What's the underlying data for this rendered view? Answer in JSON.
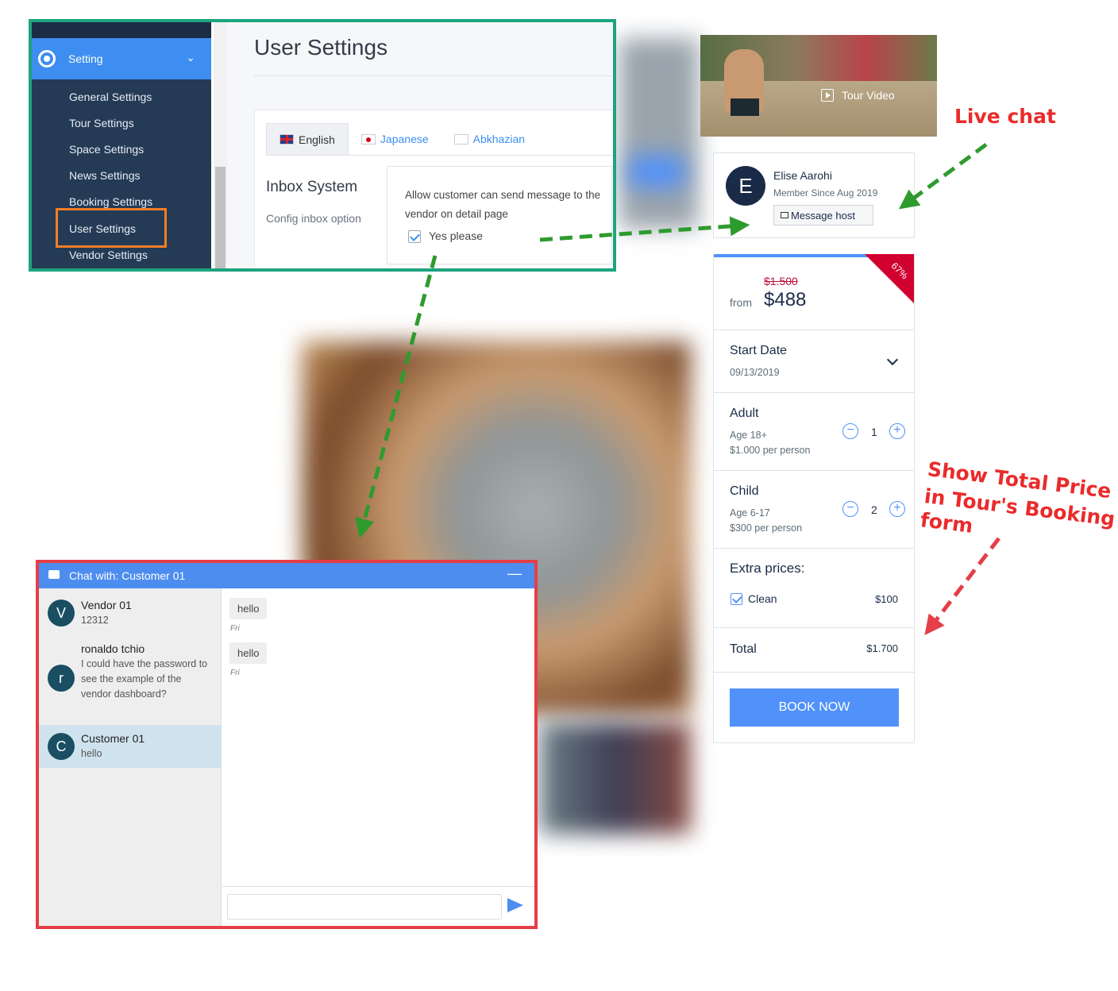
{
  "admin": {
    "menu": {
      "setting_label": "Setting",
      "items": [
        "General Settings",
        "Tour Settings",
        "Space Settings",
        "News Settings",
        "Booking Settings",
        "User Settings",
        "Vendor Settings"
      ]
    },
    "page_title": "User Settings",
    "tabs": [
      "English",
      "Japanese",
      "Abkhazian"
    ],
    "section_title": "Inbox System",
    "section_sub": "Config inbox option",
    "inbox_text": "Allow customer can send message to the vendor on detail page",
    "checkbox_label": "Yes please"
  },
  "tour": {
    "video_label": "Tour Video"
  },
  "host": {
    "initial": "E",
    "name": "Elise Aarohi",
    "member_since": "Member Since Aug 2019",
    "message_button": "Message host"
  },
  "booking": {
    "discount": "67%",
    "old_price": "$1.500",
    "from_label": "from",
    "price": "$488",
    "start_date_label": "Start Date",
    "start_date": "09/13/2019",
    "adult_label": "Adult",
    "adult_age": "Age 18+",
    "adult_price": "$1.000 per person",
    "adult_qty": "1",
    "child_label": "Child",
    "child_age": "Age 6-17",
    "child_price": "$300 per person",
    "child_qty": "2",
    "extra_label": "Extra prices:",
    "extra_item": "Clean",
    "extra_price": "$100",
    "total_label": "Total",
    "total": "$1.700",
    "book_button": "BOOK NOW"
  },
  "chat": {
    "title": "Chat with: Customer 01",
    "minimize": "—",
    "contacts": [
      {
        "initial": "V",
        "name": "Vendor 01",
        "message": "12312"
      },
      {
        "initial": "r",
        "name": "ronaldo tchio",
        "message": "I could have the password to see the example of the vendor dashboard?"
      },
      {
        "initial": "C",
        "name": "Customer 01",
        "message": "hello"
      }
    ],
    "messages": [
      {
        "text": "hello",
        "time": "Fri"
      },
      {
        "text": "hello",
        "time": "Fri"
      }
    ]
  },
  "annotations": {
    "live_chat": "Live chat",
    "total_price_1": "Show Total Price",
    "total_price_2": "in Tour's Booking",
    "total_price_3": "form"
  },
  "colors": {
    "primary": "#5191fa",
    "admin_frame": "#1ea37f",
    "chat_frame": "#e53e46",
    "highlight": "#f47d26",
    "annotation_red": "#ea2b2b",
    "arrow_green": "#2e9b2e",
    "discount_red": "#d1002e"
  }
}
